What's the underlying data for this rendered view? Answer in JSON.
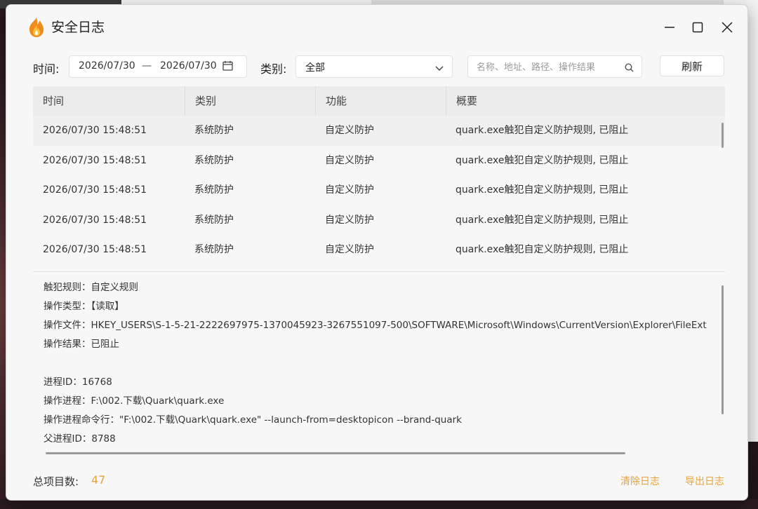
{
  "window": {
    "title": "安全日志"
  },
  "filters": {
    "time_label": "时间:",
    "date_start": "2026/07/30",
    "date_separator": "—",
    "date_end": "2026/07/30",
    "category_label": "类别:",
    "category_value": "全部",
    "search_placeholder": "名称、地址、路径、操作结果",
    "refresh_label": "刷新"
  },
  "table": {
    "headers": [
      "时间",
      "类别",
      "功能",
      "概要"
    ],
    "rows": [
      [
        "2026/07/30 15:48:51",
        "系统防护",
        "自定义防护",
        "quark.exe触犯自定义防护规则, 已阻止"
      ],
      [
        "2026/07/30 15:48:51",
        "系统防护",
        "自定义防护",
        "quark.exe触犯自定义防护规则, 已阻止"
      ],
      [
        "2026/07/30 15:48:51",
        "系统防护",
        "自定义防护",
        "quark.exe触犯自定义防护规则, 已阻止"
      ],
      [
        "2026/07/30 15:48:51",
        "系统防护",
        "自定义防护",
        "quark.exe触犯自定义防护规则, 已阻止"
      ],
      [
        "2026/07/30 15:48:51",
        "系统防护",
        "自定义防护",
        "quark.exe触犯自定义防护规则, 已阻止"
      ]
    ]
  },
  "detail": {
    "lines": [
      "触犯规则：自定义规则",
      "操作类型：【读取】",
      "操作文件：HKEY_USERS\\S-1-5-21-2222697975-1370045923-3267551097-500\\SOFTWARE\\Microsoft\\Windows\\CurrentVersion\\Explorer\\FileExt",
      "操作结果：已阻止",
      "",
      "进程ID：16768",
      "操作进程：F:\\002.下载\\Quark\\quark.exe",
      "操作进程命令行：\"F:\\002.下载\\Quark\\quark.exe\" --launch-from=desktopicon --brand-quark",
      "父进程ID：8788"
    ]
  },
  "footer": {
    "total_label": "总项目数:",
    "total_count": "47",
    "clear_label": "清除日志",
    "export_label": "导出日志"
  },
  "colors": {
    "accent": "#e8a33c",
    "logo_orange": "#f08c1e",
    "logo_yellow": "#ffc23a"
  },
  "icons": {
    "logo": "flame-shield-icon",
    "minimize": "minimize-icon",
    "maximize": "maximize-icon",
    "close": "close-icon",
    "calendar": "calendar-icon",
    "dropdown": "chevron-down-icon",
    "search": "search-icon"
  }
}
